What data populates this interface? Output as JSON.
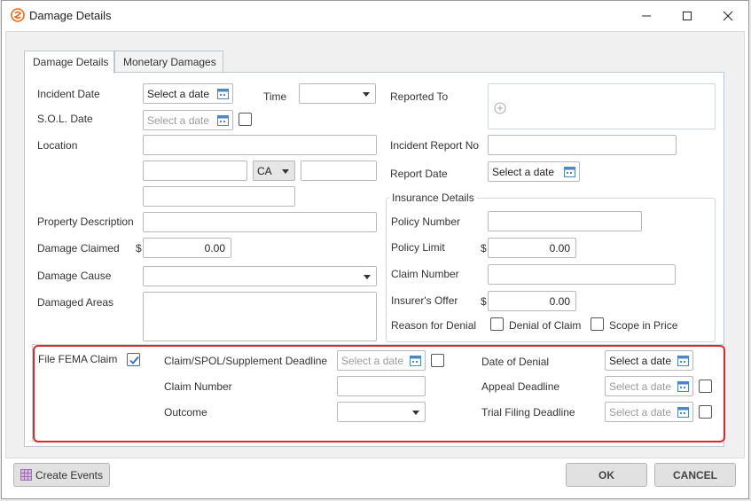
{
  "window": {
    "title": "Damage Details",
    "accent": "#e86a1c"
  },
  "tabs": [
    {
      "label": "Damage Details",
      "active": true
    },
    {
      "label": "Monetary Damages",
      "active": false
    }
  ],
  "left": {
    "incident_date": {
      "label": "Incident Date",
      "value": "Select a date"
    },
    "time": {
      "label": "Time",
      "value": ""
    },
    "sol_date": {
      "label": "S.O.L. Date",
      "placeholder": "Select a date"
    },
    "location": {
      "label": "Location",
      "state": "CA"
    },
    "property_description": {
      "label": "Property Description"
    },
    "damage_claimed": {
      "label": "Damage Claimed",
      "currency": "$",
      "value": "0.00"
    },
    "damage_cause": {
      "label": "Damage Cause"
    },
    "damaged_areas": {
      "label": "Damaged Areas"
    }
  },
  "right": {
    "reported_to": {
      "label": "Reported To"
    },
    "incident_report_no": {
      "label": "Incident Report No"
    },
    "report_date": {
      "label": "Report Date",
      "value": "Select a date"
    },
    "insurance": {
      "title": "Insurance Details",
      "policy_number": {
        "label": "Policy Number"
      },
      "policy_limit": {
        "label": "Policy Limit",
        "currency": "$",
        "value": "0.00"
      },
      "claim_number": {
        "label": "Claim Number"
      },
      "insurers_offer": {
        "label": "Insurer's Offer",
        "currency": "$",
        "value": "0.00"
      },
      "reason_for_denial": {
        "label": "Reason for Denial"
      },
      "denial_of_claim": {
        "label": "Denial of Claim",
        "checked": false
      },
      "scope_in_price": {
        "label": "Scope in Price",
        "checked": false
      }
    }
  },
  "fema": {
    "file_fema_claim": {
      "label": "File FEMA Claim",
      "checked": true
    },
    "claim_deadline": {
      "label": "Claim/SPOL/Supplement Deadline",
      "placeholder": "Select a date"
    },
    "claim_number": {
      "label": "Claim Number"
    },
    "outcome": {
      "label": "Outcome"
    },
    "date_of_denial": {
      "label": "Date of Denial",
      "value": "Select a date"
    },
    "appeal_deadline": {
      "label": "Appeal Deadline",
      "placeholder": "Select a date"
    },
    "trial_filing_deadline": {
      "label": "Trial Filing Deadline",
      "placeholder": "Select a date"
    }
  },
  "footer": {
    "create_events": "Create Events",
    "ok": "OK",
    "cancel": "CANCEL"
  },
  "icons": {
    "calendar": "calendar-icon",
    "add": "add-circle-icon",
    "events": "calendar-grid-icon"
  }
}
